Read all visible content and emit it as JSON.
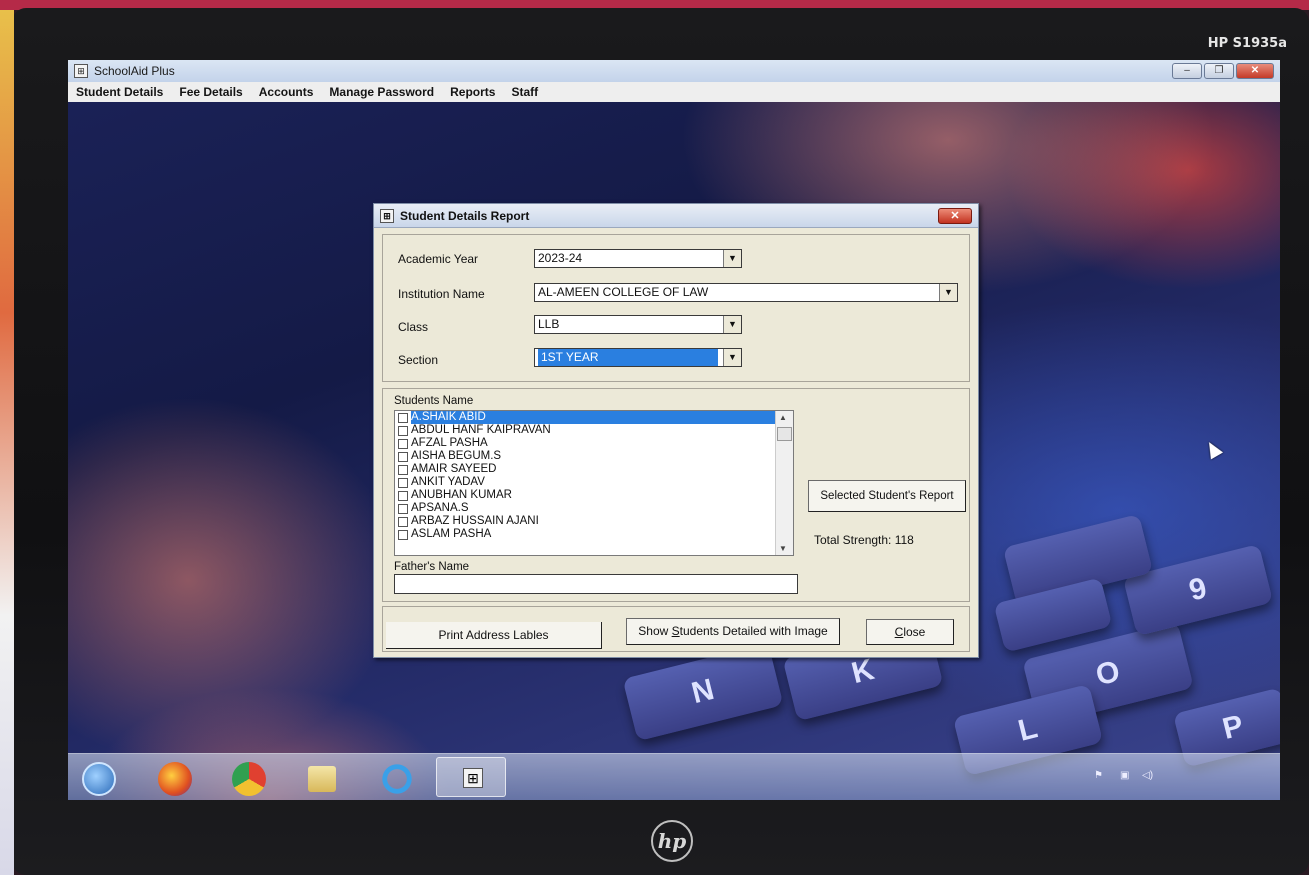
{
  "monitor": {
    "model": "HP S1935a",
    "logo": "hp"
  },
  "app": {
    "title": "SchoolAid Plus",
    "menu": [
      "Student Details",
      "Fee Details",
      "Accounts",
      "Manage Password",
      "Reports",
      "Staff"
    ]
  },
  "dialog": {
    "title": "Student Details Report",
    "close_glyph": "✕",
    "fields": {
      "academic_year": {
        "label": "Academic Year",
        "value": "2023-24"
      },
      "institution": {
        "label": "Institution Name",
        "value": "AL-AMEEN COLLEGE OF LAW"
      },
      "class": {
        "label": "Class",
        "value": "LLB"
      },
      "section": {
        "label": "Section",
        "value": "1ST YEAR"
      }
    },
    "students": {
      "label": "Students Name",
      "items": [
        "A.SHAIK ABID",
        "ABDUL HANF KAIPRAVAN",
        "AFZAL PASHA",
        "AISHA BEGUM.S",
        "AMAIR SAYEED",
        "ANKIT YADAV",
        "ANUBHAN KUMAR",
        "APSANA.S",
        "ARBAZ HUSSAIN AJANI",
        "ASLAM PASHA"
      ],
      "selected_index": 0
    },
    "selected_report_button": "Selected Student's Report",
    "total_strength": "Total Strength: 118",
    "fathers_name": {
      "label": "Father's Name",
      "value": ""
    },
    "buttons": {
      "print": "Print Address Lables",
      "show_prefix": "Show ",
      "show_u": "S",
      "show_suffix": "tudents Detailed with Image",
      "close_u": "C",
      "close_rest": "lose"
    }
  },
  "keys": [
    "N",
    "K",
    "O",
    "L",
    "9",
    "P"
  ],
  "colors": {
    "selection": "#2a7fe0",
    "dialog_bg": "#ece9d8",
    "close_red": "#c23220"
  }
}
